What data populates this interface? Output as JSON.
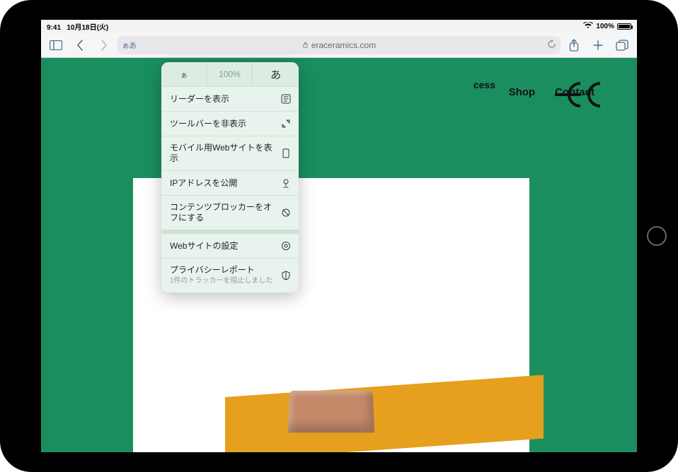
{
  "status": {
    "time": "9:41",
    "date": "10月18日(火)",
    "battery_pct": "100%"
  },
  "toolbar": {
    "aa_label": "ぁあ",
    "url": "eraceramics.com"
  },
  "site": {
    "nav_partial": "cess",
    "nav_shop": "Shop",
    "nav_contact": "Contact"
  },
  "popover": {
    "zoom_small": "ぁ",
    "zoom_value": "100%",
    "zoom_big": "あ",
    "reader": "リーダーを表示",
    "hide_toolbar": "ツールバーを非表示",
    "mobile_site": "モバイル用Webサイトを表示",
    "show_ip": "IPアドレスを公開",
    "blockers_off": "コンテンツブロッカーをオフにする",
    "site_settings": "Webサイトの設定",
    "privacy": "プライバシーレポート",
    "privacy_sub": "1件のトラッカーを阻止しました"
  }
}
